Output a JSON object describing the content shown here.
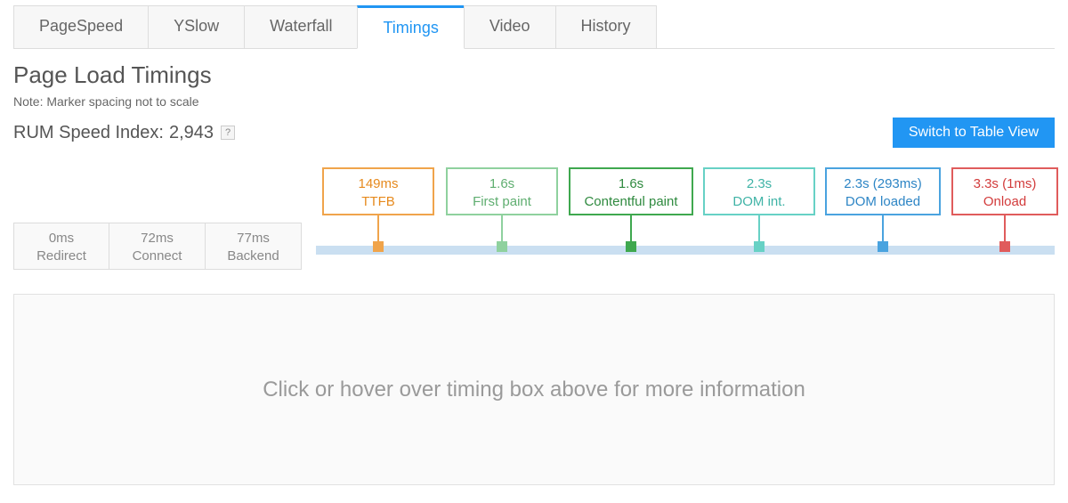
{
  "tabs": {
    "pagespeed": "PageSpeed",
    "yslow": "YSlow",
    "waterfall": "Waterfall",
    "timings": "Timings",
    "video": "Video",
    "history": "History"
  },
  "heading": "Page Load Timings",
  "note": "Note: Marker spacing not to scale",
  "rum_label": "RUM Speed Index:",
  "rum_value": "2,943",
  "help_glyph": "?",
  "switch_button": "Switch to Table View",
  "pre_timings": {
    "redirect": {
      "value": "0ms",
      "label": "Redirect"
    },
    "connect": {
      "value": "72ms",
      "label": "Connect"
    },
    "backend": {
      "value": "77ms",
      "label": "Backend"
    }
  },
  "timings": {
    "ttfb": {
      "value": "149ms",
      "label": "TTFB"
    },
    "first_paint": {
      "value": "1.6s",
      "label": "First paint"
    },
    "content_paint": {
      "value": "1.6s",
      "label": "Contentful paint"
    },
    "dom_int": {
      "value": "2.3s",
      "label": "DOM int."
    },
    "dom_loaded": {
      "value": "2.3s (293ms)",
      "label": "DOM loaded"
    },
    "onload": {
      "value": "3.3s (1ms)",
      "label": "Onload"
    }
  },
  "info_placeholder": "Click or hover over timing box above for more information"
}
